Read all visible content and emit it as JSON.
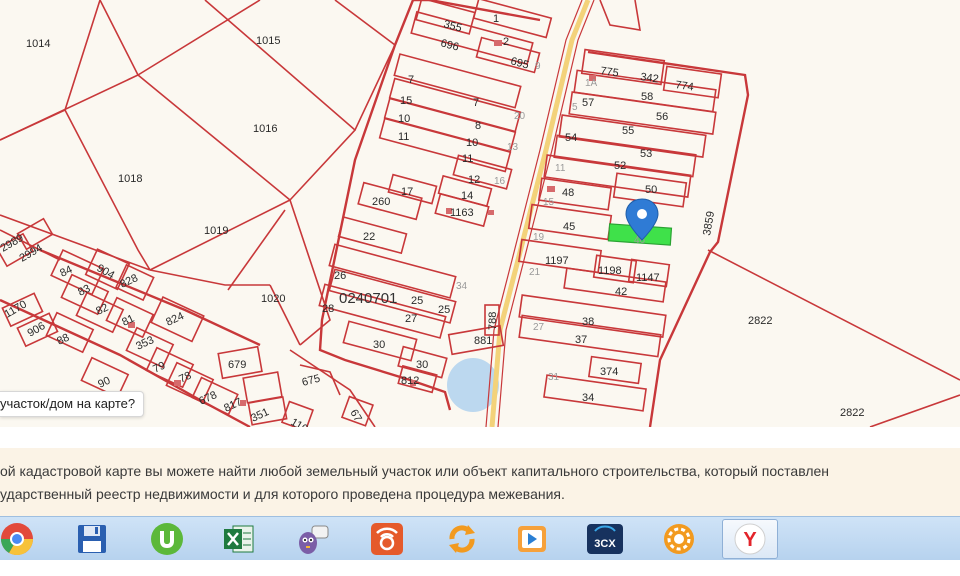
{
  "map": {
    "labels": {
      "p1014": "1014",
      "p1015": "1015",
      "p1016": "1016",
      "p1018": "1018",
      "p1019": "1019",
      "p1020": "1020",
      "p2822a": "2822",
      "p2822b": "2822",
      "p3859": "3859",
      "p0240701": "0240701",
      "p355": "355",
      "p696": "696",
      "p1": "1",
      "p2": "2",
      "p695": "695",
      "p7a": "7",
      "p7b": "7",
      "p15": "15",
      "p10a": "10",
      "p8": "8",
      "p11a": "11",
      "p10b": "10",
      "p11b": "11",
      "p12": "12",
      "p17": "17",
      "p260": "260",
      "p14": "14",
      "p1163": "1163",
      "p22": "22",
      "p26": "26",
      "p25a": "25",
      "p25b": "25",
      "p28": "28",
      "p27": "27",
      "p30a": "30",
      "p30b": "30",
      "p812": "812",
      "p881": "881",
      "p788": "788",
      "p34a": "34",
      "p775": "775",
      "p342": "342",
      "p774": "774",
      "p57": "57",
      "p58": "58",
      "p56": "56",
      "p55": "55",
      "p54": "54",
      "p53": "53",
      "p52": "52",
      "p48": "48",
      "p50": "50",
      "p45": "45",
      "p46": "46",
      "p1197": "1197",
      "p1198": "1198",
      "p1147": "1147",
      "p42": "42",
      "p38": "38",
      "p37": "37",
      "p374": "374",
      "p34b": "34",
      "p31": "31",
      "p2989": "2989",
      "p2994": "2994",
      "p84": "84",
      "p904": "904",
      "p828": "828",
      "p83": "83",
      "p1170": "1170",
      "p906": "906",
      "p82": "82",
      "p81": "81",
      "p824": "824",
      "p88": "88",
      "p353": "353",
      "p79": "79",
      "p78": "78",
      "p90": "90",
      "p679": "679",
      "p675": "675",
      "p678": "678",
      "p817": "817",
      "p351": "351",
      "p67": "67",
      "p116": "116",
      "f5": "5",
      "f1a": "1A",
      "f13": "13",
      "f11": "11",
      "f15": "15",
      "f19": "19",
      "f21": "21",
      "f27": "27",
      "f16": "16",
      "f20": "20",
      "f9": "9"
    },
    "prompt": "участок/дом на карте?"
  },
  "info": {
    "line1": "ой кадастровой карте вы можете найти любой земельный участок или объект капитального строительства, который поставлен",
    "line2": "ударственный реестр недвижимости и для которого проведена процедура межевания."
  },
  "taskbar": {
    "apps": [
      {
        "name": "chrome-icon"
      },
      {
        "name": "save-disk-icon"
      },
      {
        "name": "utorrent-icon"
      },
      {
        "name": "excel-icon"
      },
      {
        "name": "chat-bubble-icon"
      },
      {
        "name": "network-drive-icon"
      },
      {
        "name": "sync-icon"
      },
      {
        "name": "media-player-icon"
      },
      {
        "name": "3cx-icon",
        "text": "3CX"
      },
      {
        "name": "settings-gear-icon"
      },
      {
        "name": "yandex-browser-icon",
        "text": "Y"
      }
    ]
  },
  "colors": {
    "plot_border": "#c8383a",
    "highlight_plot": "#3fe14a",
    "marker": "#2f7bd5",
    "road": "#f3d27a",
    "water": "#bcd8ef"
  }
}
